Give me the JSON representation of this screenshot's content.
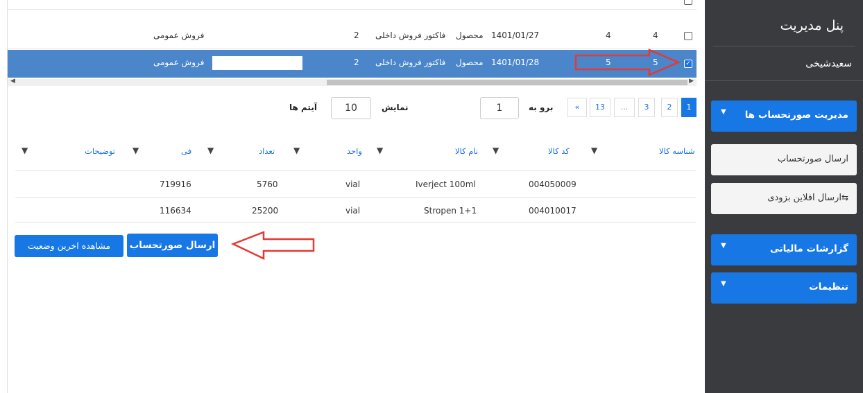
{
  "sidebar": {
    "title": "پنل مدیریت",
    "username": "سعیدشیخی",
    "menu": [
      {
        "label": "مدیریت صورتحساب ها"
      },
      {
        "label": "گزارشات مالیاتی"
      },
      {
        "label": "تنظیمات"
      }
    ],
    "subitems": [
      {
        "label": "ارسال صورتحساب"
      },
      {
        "label": "ارسال افلاین بزودی"
      }
    ]
  },
  "invoices": [
    {
      "type": "فروش عمومی",
      "count": "2",
      "invoice": "فاکتور فروش داخلی",
      "kind": "محصول",
      "date": "1401/01/27",
      "n1": "4",
      "n2": "4",
      "checked": false
    },
    {
      "type": "فروش عمومی",
      "count": "2",
      "invoice": "فاکتور فروش داخلی",
      "kind": "محصول",
      "date": "1401/01/28",
      "n1": "5",
      "n2": "5",
      "checked": true
    }
  ],
  "pagination": {
    "pages": [
      "1",
      "2",
      "3",
      "...",
      "13",
      "«"
    ],
    "goto_label": "برو به",
    "goto_value": "1",
    "show_label": "نمایش",
    "show_value": "10",
    "items_label": "آیتم ها"
  },
  "items_table": {
    "headers": {
      "id": "شناسه کالا",
      "code": "کد کالا",
      "name": "نام کالا",
      "unit": "واحد",
      "qty": "تعداد",
      "price": "فی",
      "desc": "توضیحات"
    },
    "rows": [
      {
        "code": "004050009",
        "name": "Iverject 100ml",
        "unit": "vial",
        "qty": "5760",
        "price": "719916",
        "desc": ""
      },
      {
        "code": "004010017",
        "name": "Stropen 1+1",
        "unit": "vial",
        "qty": "25200",
        "price": "116634",
        "desc": ""
      }
    ]
  },
  "actions": {
    "send": "ارسال صورتحساب",
    "status": "مشاهده اخرین وضعیت"
  },
  "colors": {
    "accent": "#1677e5",
    "sidebar": "#3a3b3e",
    "selected_row": "#4a86c9",
    "annotation_arrow": "#e53935"
  }
}
